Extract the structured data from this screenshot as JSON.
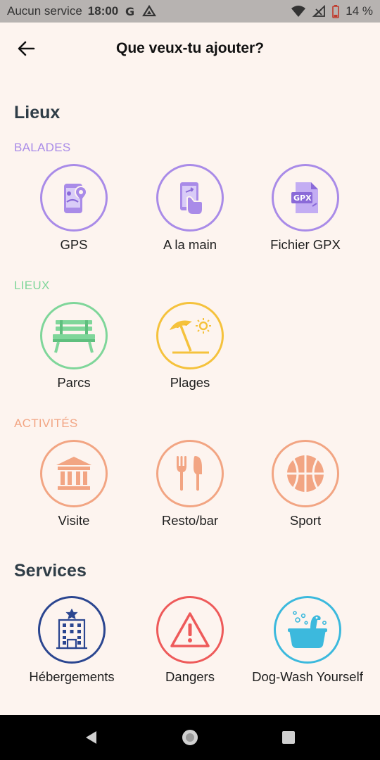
{
  "status_bar": {
    "carrier": "Aucun service",
    "time": "18:00",
    "battery": "14 %"
  },
  "header": {
    "title": "Que veux-tu ajouter?"
  },
  "sections": {
    "lieux": {
      "title": "Lieux",
      "balades": {
        "label": "BALADES",
        "color": "#a98be8",
        "items": [
          "GPS",
          "A la main",
          "Fichier GPX"
        ]
      },
      "lieux": {
        "label": "LIEUX",
        "color": "#7fd69a",
        "items": [
          "Parcs",
          "Plages"
        ]
      },
      "activites": {
        "label": "ACTIVITÉS",
        "color": "#f2a583",
        "items": [
          "Visite",
          "Resto/bar",
          "Sport"
        ]
      }
    },
    "services": {
      "title": "Services",
      "items": [
        "Hébergements",
        "Dangers",
        "Dog-Wash Yourself"
      ],
      "colors": [
        "#2b4690",
        "#ee5a5a",
        "#3cb9dd"
      ]
    }
  },
  "icons": {
    "gps": "gps-phone-icon",
    "hand": "hand-phone-icon",
    "gpx": "gpx-file-icon",
    "park": "park-bench-icon",
    "beach": "beach-umbrella-icon",
    "visit": "museum-icon",
    "resto": "fork-knife-icon",
    "sport": "basketball-icon",
    "hotel": "hotel-building-icon",
    "danger": "warning-triangle-icon",
    "dogwash": "dog-bath-icon"
  }
}
